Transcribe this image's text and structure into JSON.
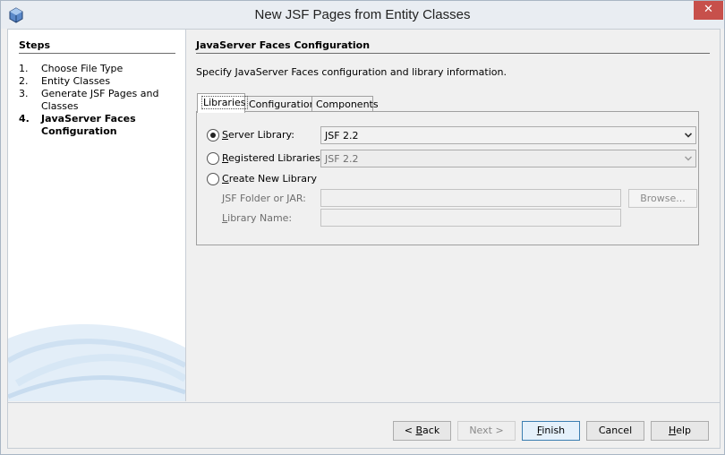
{
  "window": {
    "title": "New JSF Pages from Entity Classes",
    "close_glyph": "✕"
  },
  "steps": {
    "heading": "Steps",
    "items": [
      {
        "num": "1.",
        "label": "Choose File Type"
      },
      {
        "num": "2.",
        "label": "Entity Classes"
      },
      {
        "num": "3.",
        "label": "Generate JSF Pages and Classes"
      },
      {
        "num": "4.",
        "label": "JavaServer Faces Configuration"
      }
    ],
    "current_index": 3
  },
  "page": {
    "heading": "JavaServer Faces Configuration",
    "description": "Specify JavaServer Faces configuration and library information."
  },
  "tabs": [
    {
      "label": "Libraries",
      "active": true
    },
    {
      "label": "Configuration",
      "active": false
    },
    {
      "label": "Components",
      "active": false
    }
  ],
  "libraries": {
    "server_library": {
      "prefix": "",
      "mnemonic": "S",
      "rest": "erver Library:",
      "value": "JSF 2.2",
      "checked": true
    },
    "registered_libraries": {
      "prefix": "",
      "mnemonic": "R",
      "rest": "egistered Libraries:",
      "value": "JSF 2.2",
      "checked": false
    },
    "create_new_library": {
      "prefix": "",
      "mnemonic": "C",
      "rest": "reate New Library",
      "checked": false
    },
    "jsf_folder": {
      "mnemonic": "J",
      "rest": "SF Folder or JAR:",
      "value": ""
    },
    "library_name": {
      "mnemonic": "L",
      "rest": "ibrary Name:",
      "value": ""
    },
    "browse_label": "Browse..."
  },
  "buttons": {
    "back": {
      "prefix": "< ",
      "mnemonic": "B",
      "rest": "ack"
    },
    "next": "Next >",
    "finish": {
      "mnemonic": "F",
      "rest": "inish"
    },
    "cancel": "Cancel",
    "help": {
      "mnemonic": "H",
      "rest": "elp"
    }
  },
  "colors": {
    "title_bar": "#e9edf2",
    "close_button": "#c7504b",
    "default_button_border": "#3c7fb1"
  },
  "icons": [
    "app-cube-icon",
    "close-icon",
    "chevron-down-icon",
    "chevron-down-icon"
  ]
}
